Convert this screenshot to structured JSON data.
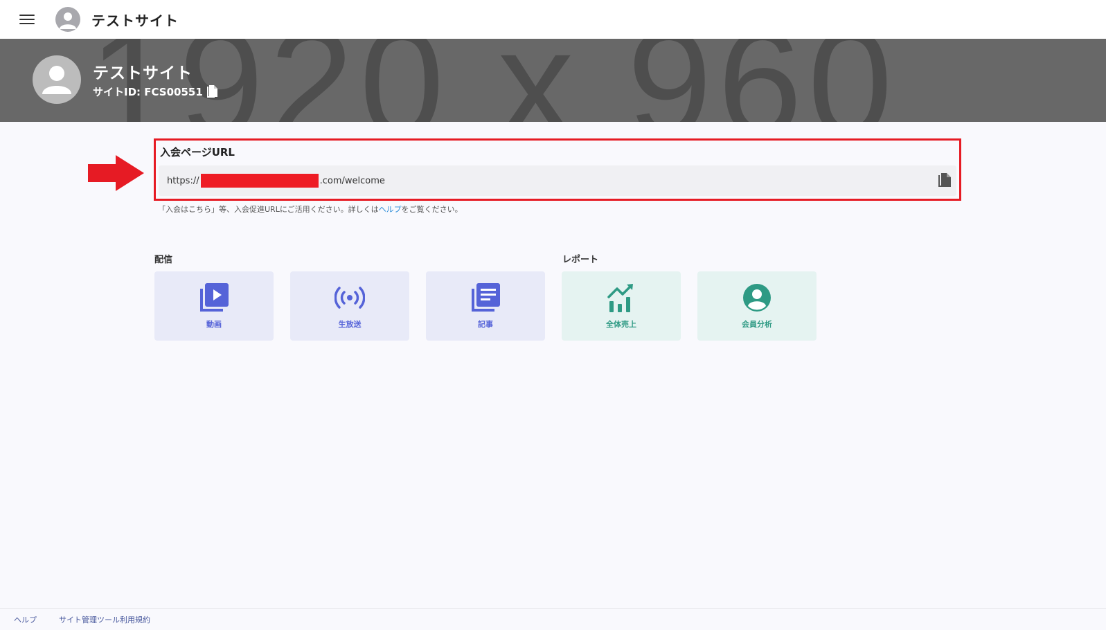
{
  "header": {
    "title": "テストサイト"
  },
  "banner": {
    "background_text": "1920 x 960",
    "site_name": "テストサイト",
    "site_id": "サイトID: FCS00551"
  },
  "join_url": {
    "label": "入会ページURL",
    "url_prefix": "https://",
    "url_suffix": ".com/welcome",
    "note_before": "「入会はこちら」等、入会促進URLにご活用ください。詳しくは",
    "note_link": "ヘルプ",
    "note_after": "をご覧ください。"
  },
  "sections": {
    "delivery_title": "配信",
    "report_title": "レポート"
  },
  "tiles": [
    {
      "label": "動画",
      "icon": "video-library-icon"
    },
    {
      "label": "生放送",
      "icon": "live-broadcast-icon"
    },
    {
      "label": "記事",
      "icon": "article-icon"
    },
    {
      "label": "全体売上",
      "icon": "sales-chart-icon"
    },
    {
      "label": "会員分析",
      "icon": "member-account-icon"
    }
  ],
  "footer": {
    "help": "ヘルプ",
    "terms": "サイト管理ツール利用規約"
  },
  "colors": {
    "accent_blue": "#5563d8",
    "accent_green": "#2e9a84",
    "highlight_red": "#e61b24"
  }
}
